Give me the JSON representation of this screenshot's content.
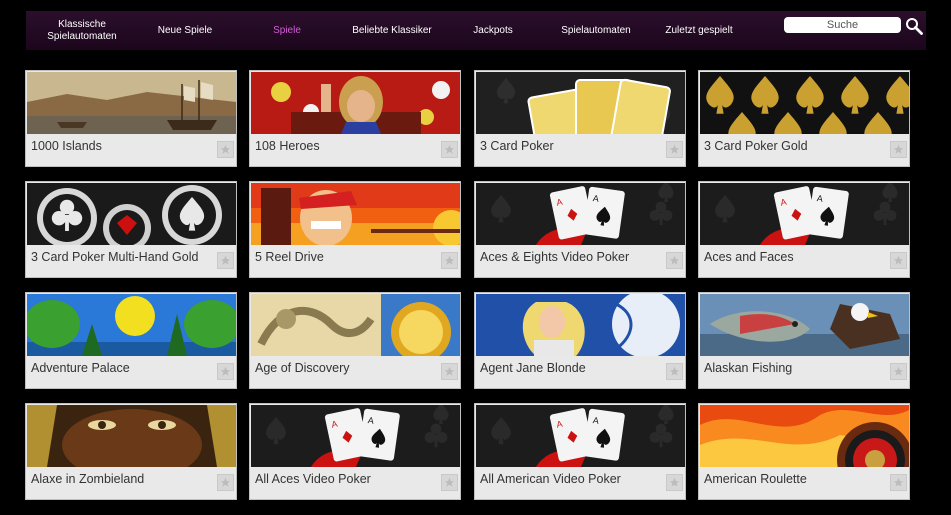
{
  "nav": {
    "items": [
      {
        "label": "Klassische Spielautomaten",
        "active": false
      },
      {
        "label": "Neue Spiele",
        "active": false
      },
      {
        "label": "Spiele",
        "active": true
      },
      {
        "label": "Beliebte Klassiker",
        "active": false
      },
      {
        "label": "Jackpots",
        "active": false
      },
      {
        "label": "Spielautomaten",
        "active": false
      },
      {
        "label": "Zuletzt gespielt",
        "active": false
      }
    ],
    "search_placeholder": "Suche",
    "accent_color": "#d45ad8"
  },
  "games": [
    {
      "title": "1000 Islands",
      "theme": "ship-painting"
    },
    {
      "title": "108 Heroes",
      "theme": "warrior-red"
    },
    {
      "title": "3 Card Poker",
      "theme": "gold-cards"
    },
    {
      "title": "3 Card Poker Gold",
      "theme": "gold-spades"
    },
    {
      "title": "3 Card Poker Multi-Hand Gold",
      "theme": "silver-suits"
    },
    {
      "title": "5 Reel Drive",
      "theme": "driver-sunset"
    },
    {
      "title": "Aces & Eights Video Poker",
      "theme": "aces-cards"
    },
    {
      "title": "Aces and Faces",
      "theme": "aces-cards"
    },
    {
      "title": "Adventure Palace",
      "theme": "jungle-sun"
    },
    {
      "title": "Age of Discovery",
      "theme": "dragon-gold"
    },
    {
      "title": "Agent Jane Blonde",
      "theme": "agent-blue"
    },
    {
      "title": "Alaskan Fishing",
      "theme": "fish-eagle"
    },
    {
      "title": "Alaxe in Zombieland",
      "theme": "zombie-face"
    },
    {
      "title": "All Aces Video Poker",
      "theme": "aces-cards"
    },
    {
      "title": "All American Video Poker",
      "theme": "aces-cards"
    },
    {
      "title": "American Roulette",
      "theme": "roulette-fire"
    }
  ]
}
